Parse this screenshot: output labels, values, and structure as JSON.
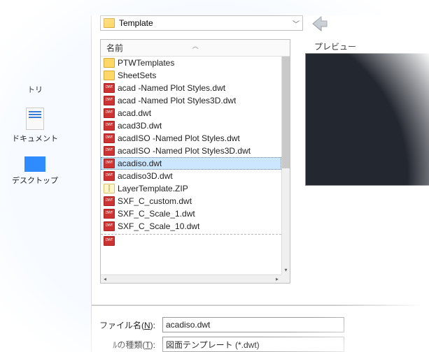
{
  "path": {
    "current": "Template"
  },
  "places": {
    "partial_top": "トリ",
    "documents": "ドキュメント",
    "desktop": "デスクトップ"
  },
  "header": {
    "name_col": "名前"
  },
  "preview_label": "プレビュー",
  "files": [
    {
      "name": "PTWTemplates",
      "kind": "folder"
    },
    {
      "name": "SheetSets",
      "kind": "folder"
    },
    {
      "name": "acad -Named Plot Styles.dwt",
      "kind": "dwt"
    },
    {
      "name": "acad -Named Plot Styles3D.dwt",
      "kind": "dwt"
    },
    {
      "name": "acad.dwt",
      "kind": "dwt"
    },
    {
      "name": "acad3D.dwt",
      "kind": "dwt"
    },
    {
      "name": "acadISO -Named Plot Styles.dwt",
      "kind": "dwt"
    },
    {
      "name": "acadISO -Named Plot Styles3D.dwt",
      "kind": "dwt"
    },
    {
      "name": "acadiso.dwt",
      "kind": "dwt",
      "selected": true
    },
    {
      "name": "acadiso3D.dwt",
      "kind": "dwt"
    },
    {
      "name": "LayerTemplate.ZIP",
      "kind": "zip"
    },
    {
      "name": "SXF_C_custom.dwt",
      "kind": "dwt"
    },
    {
      "name": "SXF_C_Scale_1.dwt",
      "kind": "dwt"
    },
    {
      "name": "SXF_C_Scale_10.dwt",
      "kind": "dwt"
    }
  ],
  "fields": {
    "filename_label_pre": "ファイル名(",
    "filename_label_key": "N",
    "filename_label_post": "):",
    "filename_value": "acadiso.dwt",
    "filetype_label_pre": "ﾙの種類(",
    "filetype_label_key": "T",
    "filetype_label_post": "):",
    "filetype_value": "図面テンプレート (*.dwt)"
  }
}
